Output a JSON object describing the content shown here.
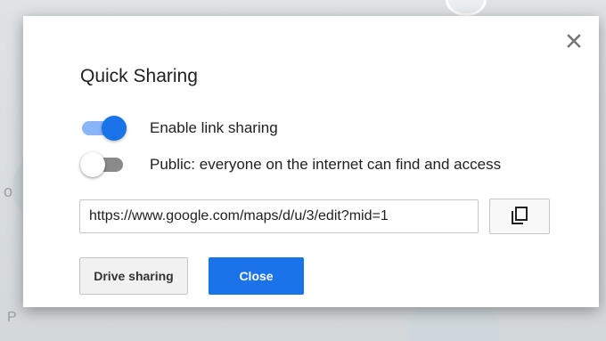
{
  "background": {
    "left_fragment": "o",
    "bottom_fragment": "P"
  },
  "dialog": {
    "title": "Quick Sharing",
    "close_icon": "close-x-icon",
    "toggles": [
      {
        "label": "Enable link sharing",
        "state": "on"
      },
      {
        "label": "Public: everyone on the internet can find and access",
        "state": "off"
      }
    ],
    "link": {
      "value": "https://www.google.com/maps/d/u/3/edit?mid=1"
    },
    "copy_icon": "copy-icon",
    "buttons": {
      "drive_sharing": "Drive sharing",
      "close": "Close"
    }
  },
  "colors": {
    "accent": "#1a73e8",
    "toggle_on_track": "#8ab4f8",
    "toggle_off_track": "#8a8a8a"
  }
}
